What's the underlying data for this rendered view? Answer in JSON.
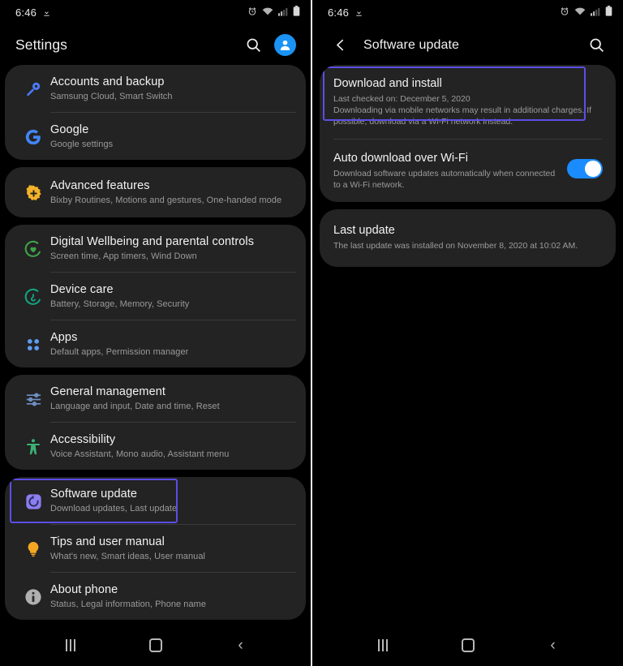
{
  "left": {
    "statusbar": {
      "time": "6:46",
      "download_icon": "download-icon",
      "icons": [
        "alarm-icon",
        "wifi-icon",
        "signal-icon",
        "battery-icon"
      ]
    },
    "actionbar": {
      "title": "Settings",
      "search_icon": "search-icon",
      "avatar_icon": "account-avatar-icon"
    },
    "groups": [
      {
        "items": [
          {
            "icon": "key-icon",
            "color": "#4a7bf7",
            "title": "Accounts and backup",
            "subtitle": "Samsung Cloud, Smart Switch"
          },
          {
            "icon": "google-g-icon",
            "color": "#4285f4",
            "title": "Google",
            "subtitle": "Google settings"
          }
        ]
      },
      {
        "items": [
          {
            "icon": "gear-plus-icon",
            "color": "#f3b229",
            "title": "Advanced features",
            "subtitle": "Bixby Routines, Motions and gestures, One-handed mode"
          }
        ]
      },
      {
        "items": [
          {
            "icon": "wellbeing-heart-icon",
            "color": "#3ea34a",
            "title": "Digital Wellbeing and parental controls",
            "subtitle": "Screen time, App timers, Wind Down"
          },
          {
            "icon": "device-care-icon",
            "color": "#13a37f",
            "title": "Device care",
            "subtitle": "Battery, Storage, Memory, Security"
          },
          {
            "icon": "apps-grid-icon",
            "color": "#5e9cf0",
            "title": "Apps",
            "subtitle": "Default apps, Permission manager"
          }
        ]
      },
      {
        "items": [
          {
            "icon": "sliders-icon",
            "color": "#6f8fc4",
            "title": "General management",
            "subtitle": "Language and input, Date and time, Reset"
          },
          {
            "icon": "accessibility-person-icon",
            "color": "#3bb273",
            "title": "Accessibility",
            "subtitle": "Voice Assistant, Mono audio, Assistant menu"
          }
        ]
      },
      {
        "items": [
          {
            "icon": "software-update-icon",
            "color": "#6c5ce7",
            "title": "Software update",
            "subtitle": "Download updates, Last update",
            "highlighted": true
          },
          {
            "icon": "lightbulb-icon",
            "color": "#f5a623",
            "title": "Tips and user manual",
            "subtitle": "What's new, Smart ideas, User manual"
          },
          {
            "icon": "info-circle-icon",
            "color": "#b0b0b0",
            "title": "About phone",
            "subtitle": "Status, Legal information, Phone name"
          }
        ]
      }
    ],
    "navbar": {
      "recents": "recents-icon",
      "home": "home-icon",
      "back": "back-icon"
    }
  },
  "right": {
    "statusbar": {
      "time": "6:46",
      "download_icon": "download-icon",
      "icons": [
        "alarm-icon",
        "wifi-icon",
        "signal-icon",
        "battery-icon"
      ]
    },
    "actionbar": {
      "back_icon": "back-arrow-icon",
      "title": "Software update",
      "search_icon": "search-icon"
    },
    "cards": [
      {
        "rows": [
          {
            "title": "Download and install",
            "lines": [
              "Last checked on: December 5, 2020",
              "Downloading via mobile networks may result in additional charges. If possible, download via a Wi-Fi network instead."
            ],
            "highlighted": true
          },
          {
            "title": "Auto download over Wi-Fi",
            "lines": [
              "Download software updates automatically when connected to a Wi-Fi network."
            ],
            "toggle": {
              "name": "auto-download-toggle",
              "state": "on",
              "color": "#1a8cff"
            }
          }
        ]
      },
      {
        "rows": [
          {
            "title": "Last update",
            "lines": [
              "The last update was installed on November 8, 2020 at 10:02 AM."
            ]
          }
        ]
      }
    ],
    "navbar": {
      "recents": "recents-icon",
      "home": "home-icon",
      "back": "back-icon"
    }
  },
  "theme": {
    "card_bg": "#232323",
    "page_bg": "#000000",
    "highlight": "#5c4ee5",
    "accent_blue": "#1a8cff"
  }
}
